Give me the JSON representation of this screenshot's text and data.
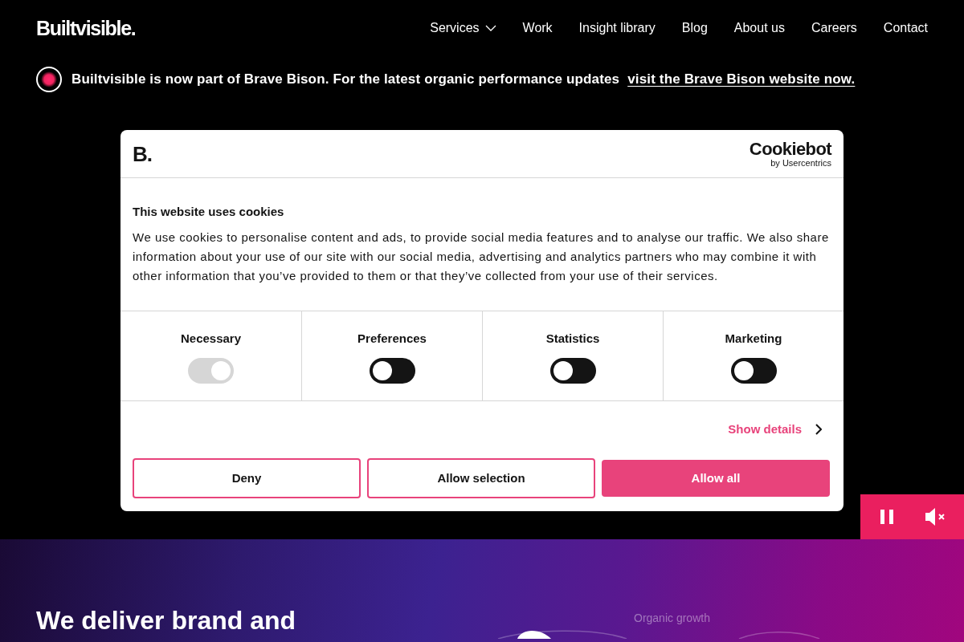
{
  "header": {
    "logo": "Builtvisible.",
    "nav": [
      {
        "label": "Services",
        "dropdown": true
      },
      {
        "label": "Work",
        "dropdown": false
      },
      {
        "label": "Insight library",
        "dropdown": false
      },
      {
        "label": "Blog",
        "dropdown": false
      },
      {
        "label": "About us",
        "dropdown": false
      },
      {
        "label": "Careers",
        "dropdown": false
      },
      {
        "label": "Contact",
        "dropdown": false
      }
    ]
  },
  "announcement": {
    "text": "Builtvisible is now part of Brave Bison. For the latest organic performance updates",
    "link": "visit the Brave Bison website now."
  },
  "cookie_dialog": {
    "brand_logo": "B.",
    "provider_logo": {
      "name": "Cookiebot",
      "tagline": "by Usercentrics"
    },
    "title": "This website uses cookies",
    "body": "We use cookies to personalise content and ads, to provide social media features and to analyse our traffic. We also share information about your use of our site with our social media, advertising and analytics partners who may combine it with other information that you’ve provided to them or that they’ve collected from your use of their services.",
    "categories": [
      {
        "label": "Necessary",
        "checked": true,
        "disabled": true
      },
      {
        "label": "Preferences",
        "checked": false,
        "disabled": false
      },
      {
        "label": "Statistics",
        "checked": false,
        "disabled": false
      },
      {
        "label": "Marketing",
        "checked": false,
        "disabled": false
      }
    ],
    "show_details": "Show details",
    "buttons": [
      {
        "label": "Deny",
        "kind": "outline"
      },
      {
        "label": "Allow selection",
        "kind": "outline"
      },
      {
        "label": "Allow all",
        "kind": "filled"
      }
    ]
  },
  "media_controls": {
    "playing": true,
    "muted": true
  },
  "hero": {
    "heading": "We deliver brand and",
    "chart_label": "Organic growth"
  }
}
